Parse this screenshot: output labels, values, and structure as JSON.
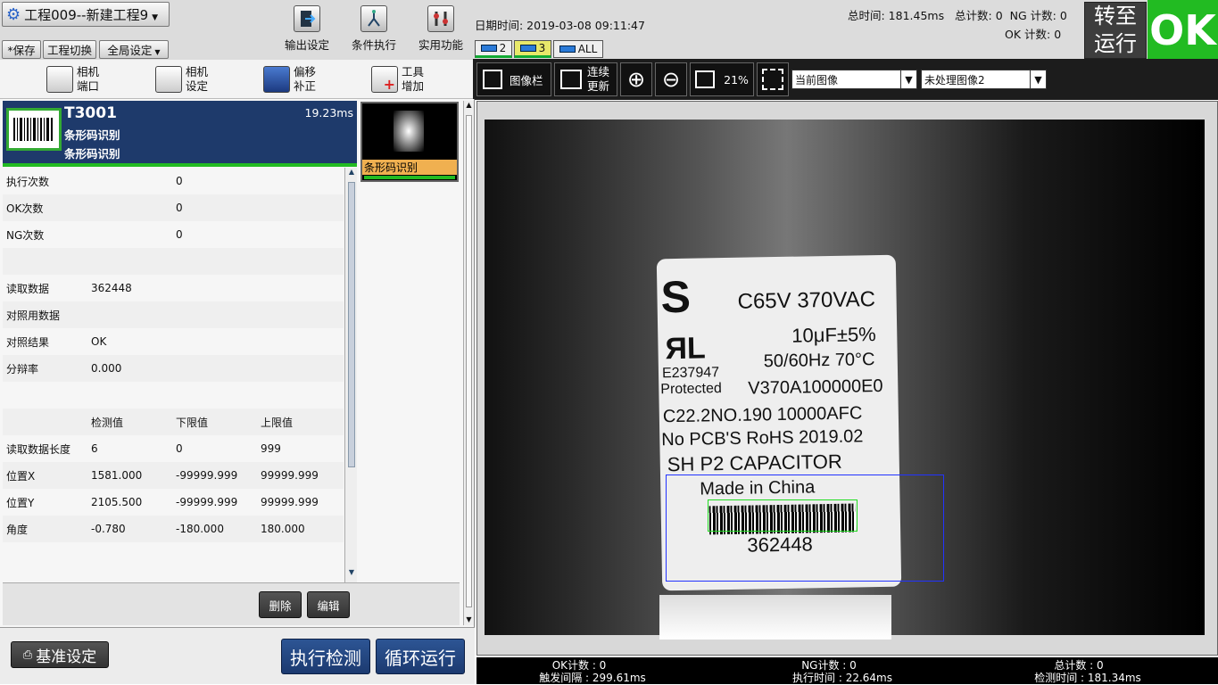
{
  "project": {
    "title": "工程009--新建工程9"
  },
  "menu": {
    "save": "*保存",
    "switch": "工程切换",
    "global": "全局设定"
  },
  "toolbar": {
    "output": "输出设定",
    "condition": "条件执行",
    "utility": "实用功能"
  },
  "datetime": "日期时间: 2019-03-08 09:11:47",
  "stats_top": {
    "total_time": "总时间: 181.45ms",
    "total_count": "总计数: 0",
    "ng_count": "NG 计数: 0",
    "ok_count": "OK 计数: 0"
  },
  "run_button": {
    "line1": "转至",
    "line2": "运行"
  },
  "result": {
    "label": "OK",
    "color": "#22bb22"
  },
  "cams": [
    {
      "label": "2"
    },
    {
      "label": "3"
    },
    {
      "label": "ALL"
    }
  ],
  "tools": [
    {
      "l1": "相机",
      "l2": "端口"
    },
    {
      "l1": "相机",
      "l2": "设定"
    },
    {
      "l1": "偏移",
      "l2": "补正"
    },
    {
      "l1": "工具",
      "l2": "增加"
    }
  ],
  "viewer": {
    "image_bar": "图像栏",
    "cont1": "连续",
    "cont2": "更新",
    "zoom": "21%",
    "sel1": "当前图像",
    "sel2": "未处理图像2"
  },
  "tool_header": {
    "id": "T3001",
    "name1": "条形码识别",
    "name2": "条形码识别",
    "time": "19.23ms"
  },
  "thumb": {
    "label": "条形码识别"
  },
  "rows": [
    {
      "c1": "执行次数",
      "c2": "",
      "c3": "0",
      "c4": ""
    },
    {
      "c1": "OK次数",
      "c2": "",
      "c3": "0",
      "c4": ""
    },
    {
      "c1": "NG次数",
      "c2": "",
      "c3": "0",
      "c4": ""
    },
    {
      "c1": "",
      "c2": "",
      "c3": "",
      "c4": ""
    },
    {
      "c1": "读取数据",
      "c2": "362448",
      "c3": "",
      "c4": ""
    },
    {
      "c1": "对照用数据",
      "c2": "",
      "c3": "",
      "c4": ""
    },
    {
      "c1": "对照结果",
      "c2": "OK",
      "c3": "",
      "c4": ""
    },
    {
      "c1": "分辩率",
      "c2": "0.000",
      "c3": "",
      "c4": ""
    },
    {
      "c1": "",
      "c2": "",
      "c3": "",
      "c4": ""
    },
    {
      "c1": "",
      "c2": "检测值",
      "c3": "下限值",
      "c4": "上限值"
    },
    {
      "c1": "读取数据长度",
      "c2": "6",
      "c3": "0",
      "c4": "999"
    },
    {
      "c1": "位置X",
      "c2": "1581.000",
      "c3": "-99999.999",
      "c4": "99999.999"
    },
    {
      "c1": "位置Y",
      "c2": "2105.500",
      "c3": "-99999.999",
      "c4": "99999.999"
    },
    {
      "c1": "角度",
      "c2": "-0.780",
      "c3": "-180.000",
      "c4": "180.000"
    },
    {
      "c1": "",
      "c2": "",
      "c3": "",
      "c4": ""
    }
  ],
  "actions": {
    "delete": "删除",
    "edit": "编辑",
    "baseline": "基准设定",
    "execute": "执行检测",
    "loop": "循环运行"
  },
  "label": {
    "l1": "C65V 370VAC",
    "l2": "10μF±5%",
    "l3": "50/60Hz 70°C",
    "l4a": "E237947",
    "l4b": "Protected",
    "l5": "V370A100000E0",
    "l6": "C22.2NO.190 10000AFC",
    "l7": "No PCB'S RoHS 2019.02",
    "l8": "SH P2 CAPACITOR",
    "l9": "Made in China",
    "code": "362448"
  },
  "status": {
    "ok_count": "OK计数 : 0",
    "trigger": "触发间隔 : 299.61ms",
    "ng_count": "NG计数 : 0",
    "exec_time": "执行时间 : 22.64ms",
    "total": "总计数 : 0",
    "detect_time": "检测时间 : 181.34ms"
  }
}
